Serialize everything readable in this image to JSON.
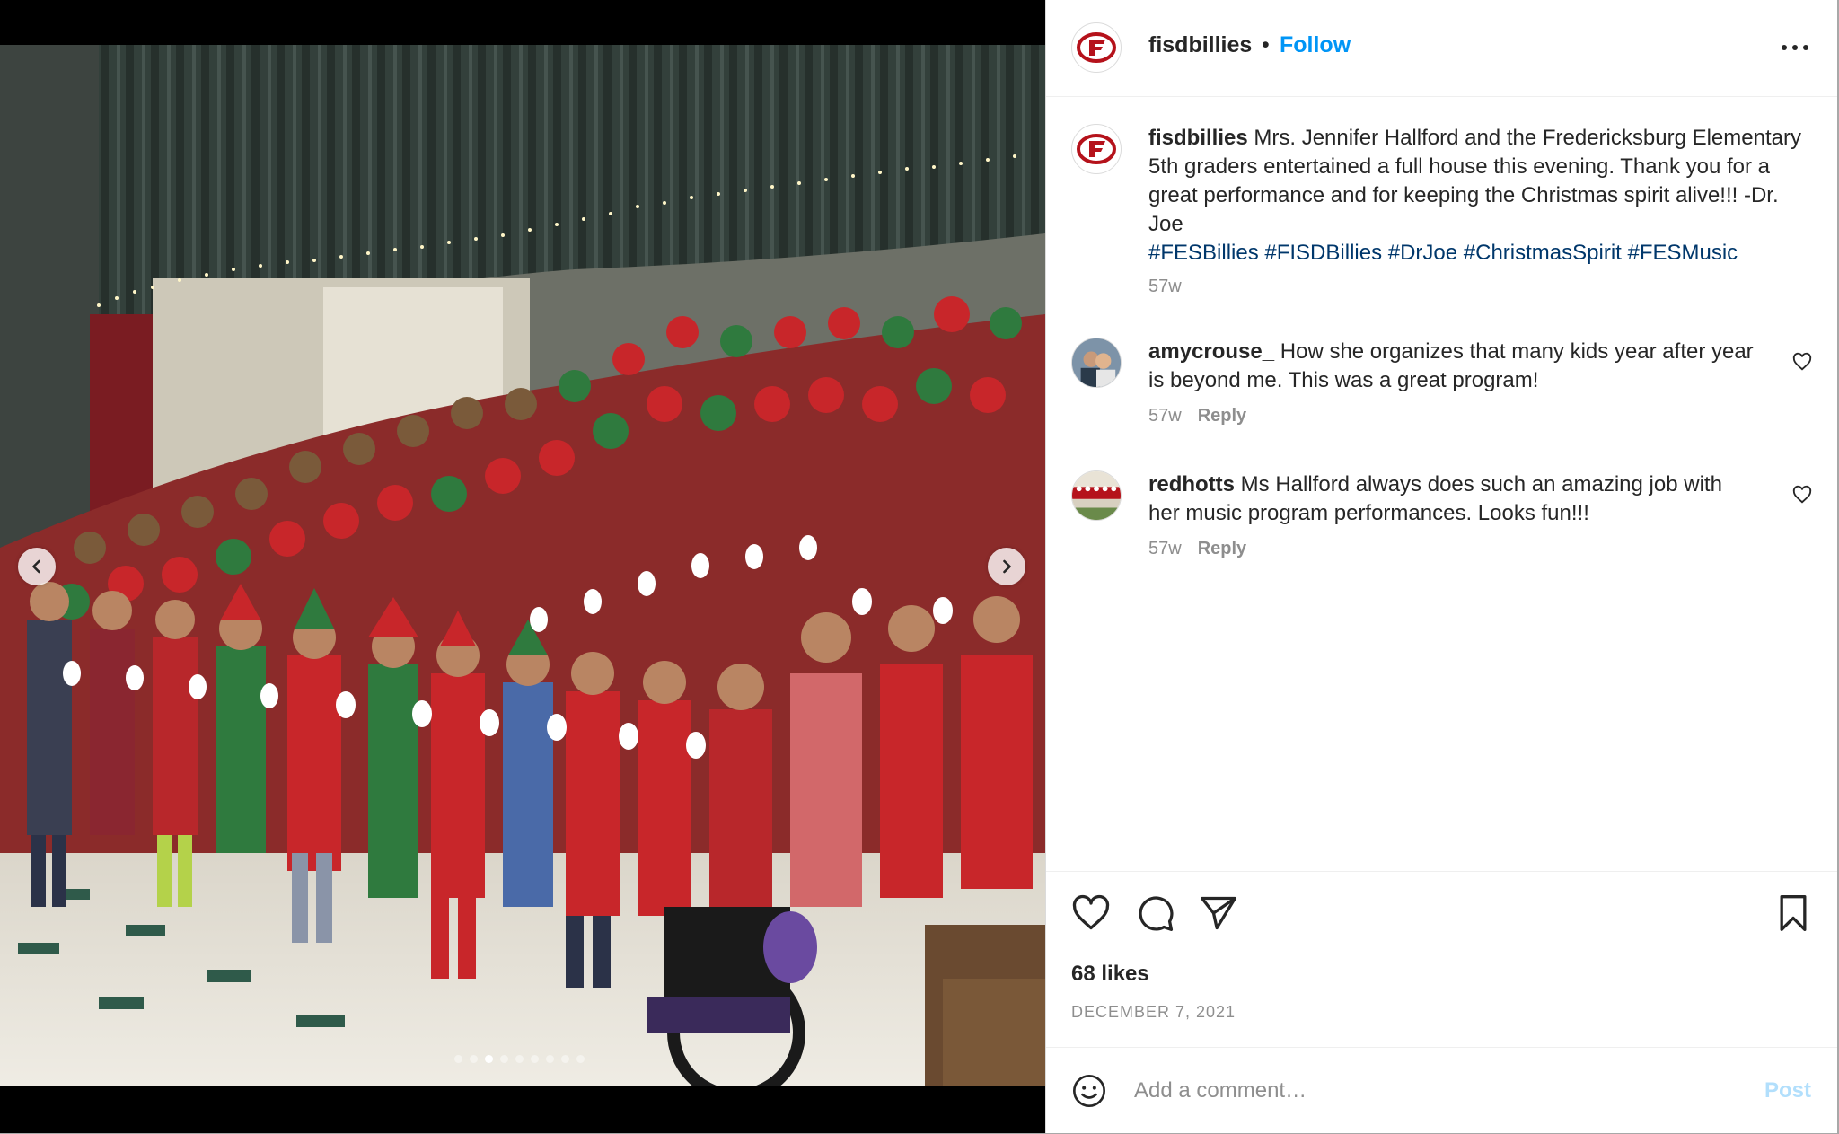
{
  "post": {
    "username": "fisdbillies",
    "separator": "•",
    "follow_label": "Follow",
    "caption_text": "Mrs. Jennifer Hallford and the Fredericksburg Elementary 5th graders entertained a full house this evening. Thank you for a great performance and for keeping the Christmas spirit alive!!! -Dr. Joe",
    "hashtags": "#FESBillies #FISDBillies #DrJoe #ChristmasSpirit #FESMusic",
    "caption_time": "57w",
    "likes": "68 likes",
    "date": "DECEMBER 7, 2021",
    "logo_letter": "F"
  },
  "comments": [
    {
      "username": "amycrouse_",
      "text": "How she organizes that many kids year after year is beyond me. This was a great program!",
      "time": "57w",
      "reply_label": "Reply"
    },
    {
      "username": "redhotts",
      "text": "Ms Hallford always does such an amazing job with her music program performances. Looks fun!!!",
      "time": "57w",
      "reply_label": "Reply"
    }
  ],
  "carousel": {
    "total_slides": 9,
    "active_index": 2
  },
  "comment_box": {
    "placeholder": "Add a comment…",
    "post_label": "Post"
  },
  "colors": {
    "link_blue": "#0095f6",
    "hashtag_blue": "#00376b",
    "muted": "#8e8e8e",
    "logo_red": "#b5121b"
  },
  "icons": [
    "chevron-left-icon",
    "chevron-right-icon",
    "more-horizontal-icon",
    "heart-icon",
    "comment-icon",
    "share-icon",
    "bookmark-icon",
    "emoji-icon"
  ]
}
